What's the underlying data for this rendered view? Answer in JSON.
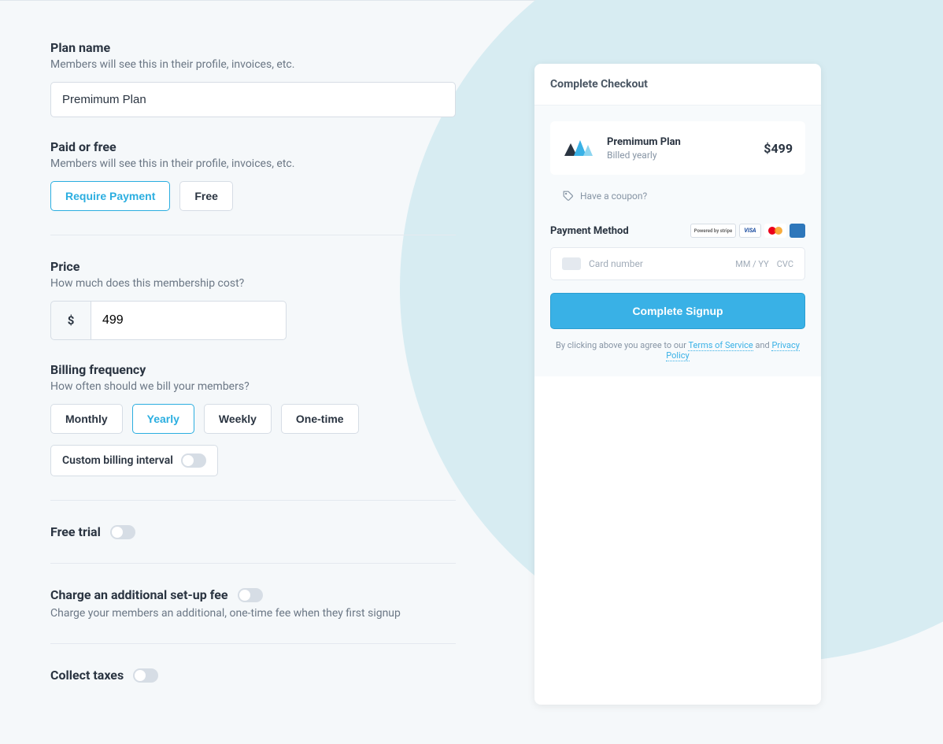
{
  "plan_name": {
    "label": "Plan name",
    "help": "Members will see this in their profile, invoices, etc.",
    "value": "Premimum Plan"
  },
  "paid_or_free": {
    "label": "Paid or free",
    "help": "Members will see this in their profile, invoices, etc.",
    "options": {
      "require_payment": "Require Payment",
      "free": "Free"
    }
  },
  "price": {
    "label": "Price",
    "help": "How much does this membership cost?",
    "currency_symbol": "$",
    "value": "499"
  },
  "billing_frequency": {
    "label": "Billing frequency",
    "help": "How often should we bill your members?",
    "options": {
      "monthly": "Monthly",
      "yearly": "Yearly",
      "weekly": "Weekly",
      "one_time": "One-time"
    },
    "custom_label": "Custom billing interval"
  },
  "free_trial": {
    "label": "Free trial"
  },
  "setup_fee": {
    "label": "Charge an additional set-up fee",
    "help": "Charge your members an additional, one-time fee when they first signup"
  },
  "collect_taxes": {
    "label": "Collect taxes"
  },
  "preview": {
    "header": "Complete Checkout",
    "plan_name": "Premimum Plan",
    "billed": "Billed yearly",
    "price": "$499",
    "coupon_text": "Have a coupon?",
    "payment_method_label": "Payment Method",
    "stripe_badge": "Powered by stripe",
    "card_placeholder": "Card number",
    "card_expiry": "MM / YY",
    "card_cvc": "CVC",
    "complete_button": "Complete Signup",
    "terms_prefix": "By clicking above you agree to our ",
    "terms_link": "Terms of Service",
    "terms_and": " and ",
    "privacy_link": "Privacy Policy"
  }
}
